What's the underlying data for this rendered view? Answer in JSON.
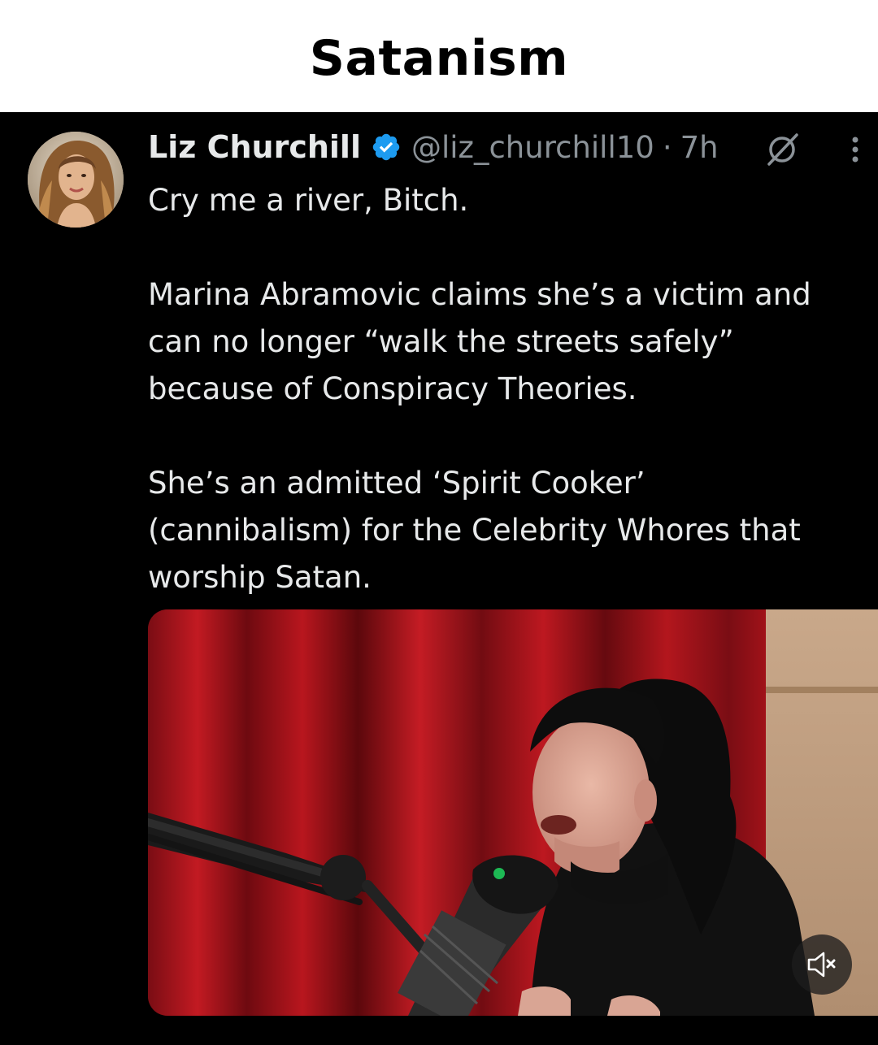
{
  "header": {
    "title": "Satanism"
  },
  "post": {
    "author_name": "Liz Churchill",
    "handle": "@liz_churchill10",
    "separator": "·",
    "time": "7h",
    "text_lines": [
      "Cry me a river, Bitch.",
      "",
      "Marina Abramovic claims she’s a victim and",
      "can no longer “walk the streets safely”",
      "because of Conspiracy Theories.",
      "",
      "She’s an admitted ‘Spirit Cooker’",
      "(cannibalism) for the Celebrity Whores that",
      "worship Satan."
    ],
    "icons": {
      "verified": "verified-badge-icon",
      "grok": "grok-icon",
      "more": "more-options-icon",
      "mute": "volume-muted-icon"
    },
    "colors": {
      "verified": "#1d9bf0",
      "text": "#e7e9ea",
      "secondary": "#8b9298"
    }
  }
}
